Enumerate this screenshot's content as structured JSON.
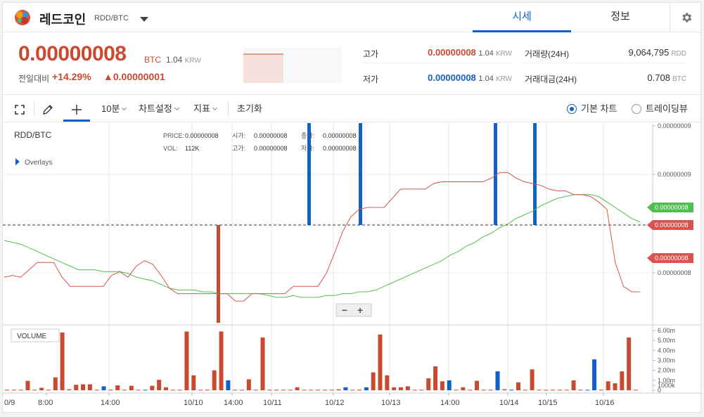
{
  "header": {
    "coin_name": "레드코인",
    "pair": "RDD/BTC",
    "tabs": [
      {
        "label": "시세",
        "active": true
      },
      {
        "label": "정보",
        "active": false
      }
    ]
  },
  "summary": {
    "price": "0.00000008",
    "price_unit": "BTC",
    "price_krw": "1.04",
    "price_krw_unit": "KRW",
    "change_label": "전일대비",
    "change_pct": "+14.29%",
    "change_amt": "▲0.00000001",
    "high_label": "고가",
    "high_value": "0.00000008",
    "high_krw": "1.04",
    "low_label": "저가",
    "low_value": "0.00000008",
    "low_krw": "1.04",
    "krw_unit": "KRW",
    "volume_label": "거래량(24H)",
    "volume_value": "9,064,795",
    "volume_unit": "RDD",
    "amount_label": "거래대금(24H)",
    "amount_value": "0.708",
    "amount_unit": "BTC"
  },
  "toolbar": {
    "interval": "10분",
    "chart_settings": "차트설정",
    "indicators": "지표",
    "reset": "초기화",
    "basic_chart": "기본 차트",
    "tradingview": "트레이딩뷰",
    "selected_mode": "basic"
  },
  "colors": {
    "up": "#c84a31",
    "down": "#1261c4",
    "ma_line": "#4fbf4f",
    "price_line": "#d9534f"
  },
  "chart_data": {
    "type": "line",
    "title": "RDD/BTC",
    "overlays_label": "Overlays",
    "legend": {
      "price_label": "PRICE:",
      "price_value": "0.00000008",
      "vol_label": "VOL:",
      "vol_value": "112K",
      "open_label": "시가:",
      "open_value": "0.00000008",
      "high_label": "고가:",
      "high_value": "0.00000008",
      "close_label": "종가:",
      "close_value": "0.00000008",
      "low_label": "저가:",
      "low_value": "0.00000008"
    },
    "price_axis_ticks": [
      "0.00000009",
      "0.00000009",
      "0.00000008",
      "0.00000008"
    ],
    "price_tags": [
      {
        "label": "0.00000008",
        "color": "#4fbf4f"
      },
      {
        "label": "0.00000008",
        "color": "#d9534f"
      },
      {
        "label": "0.00000008",
        "color": "#d9534f"
      }
    ],
    "time_labels": [
      "0/9",
      "8:00",
      "14:00",
      "10/10",
      "14:00",
      "10/11",
      "10/12",
      "10/13",
      "14:00",
      "10/14",
      "10/15",
      "10/16"
    ],
    "volume_label": "VOLUME",
    "volume_axis_ticks": [
      "6.00m",
      "5.00m",
      "4.00m",
      "3.00m",
      "2.00m",
      "1.00m",
      "1000k",
      "0"
    ],
    "series": [
      {
        "name": "MA",
        "values": [
          84.1,
          84.0,
          83.9,
          83.7,
          83.5,
          83.3,
          83.1,
          82.9,
          82.7,
          82.5,
          82.5,
          82.5,
          82.4,
          82.4,
          82.4,
          82.3,
          82.1,
          82.0,
          81.9,
          81.7,
          81.5,
          81.4,
          81.4,
          81.4,
          81.3,
          81.3,
          81.2,
          81.2,
          81.2,
          81.2,
          81.2,
          81.2,
          81.1,
          81.0,
          81.0,
          81.1,
          81.0,
          81.0,
          81.0,
          81.1,
          81.1,
          81.2,
          81.2,
          81.3,
          81.3,
          81.4,
          81.6,
          81.8,
          82.0,
          82.2,
          82.4,
          82.6,
          82.8,
          83.0,
          83.3,
          83.5,
          83.8,
          84.0,
          84.3,
          84.5,
          84.8,
          85.0,
          85.3,
          85.5,
          85.7,
          86.0,
          86.2,
          86.4,
          86.5,
          86.6,
          86.6,
          86.6,
          86.5,
          86.2,
          85.9,
          85.6,
          85.3,
          85.1
        ]
      },
      {
        "name": "Price",
        "values": [
          82.1,
          82.2,
          82.1,
          82.5,
          82.9,
          82.9,
          82.9,
          82.1,
          81.6,
          81.6,
          81.6,
          81.6,
          81.6,
          82.2,
          82.4,
          82.1,
          82.7,
          83.0,
          82.8,
          82.2,
          81.5,
          81.2,
          81.2,
          81.2,
          81.2,
          81.2,
          81.2,
          81.2,
          80.8,
          80.8,
          81.2,
          81.2,
          81.2,
          81.2,
          81.2,
          81.6,
          81.6,
          81.6,
          81.6,
          82.3,
          83.4,
          84.6,
          85.4,
          85.8,
          85.9,
          85.9,
          85.9,
          86.4,
          86.9,
          86.9,
          86.9,
          86.9,
          87.2,
          87.3,
          87.3,
          87.3,
          87.3,
          87.3,
          87.3,
          87.5,
          87.8,
          87.8,
          87.5,
          87.3,
          87.2,
          87.1,
          86.9,
          86.8,
          86.8,
          86.6,
          86.6,
          86.5,
          86.2,
          85.8,
          82.9,
          81.6,
          81.3,
          81.3
        ]
      }
    ],
    "volume_values": [
      0.05,
      0.05,
      0.05,
      0.95,
      0.05,
      0.25,
      0.05,
      1.3,
      5.8,
      0.1,
      0.55,
      0.6,
      0.6,
      0.05,
      0.4,
      0.05,
      0.5,
      0.05,
      0.45,
      0.05,
      0.05,
      0.45,
      1.05,
      0.3,
      0.05,
      0.05,
      5.9,
      1.5,
      0.05,
      0.05,
      2.0,
      5.9,
      1.0,
      0.05,
      0.05,
      1.1,
      0.05,
      5.3,
      0.05,
      0.05,
      0.05,
      0.05,
      0.3,
      0.05,
      0.05,
      0.05,
      0.05,
      0.05,
      0.1,
      0.3,
      0.05,
      0.05,
      0.3,
      1.8,
      5.6,
      1.5,
      0.3,
      0.3,
      0.4,
      0.05,
      0.05,
      1.2,
      2.4,
      0.9,
      1.0,
      0.05,
      0.3,
      0.05,
      0.95,
      0.05,
      0.05,
      1.9,
      0.1,
      0.05,
      0.8,
      0.05,
      2.1,
      0.05,
      0.05,
      0.05,
      0.05,
      0.05,
      1.0,
      0.05,
      0.05,
      3.1,
      0.05,
      0.9,
      0.7,
      1.9,
      5.3,
      0.05
    ],
    "volume_colors": "mixed"
  }
}
